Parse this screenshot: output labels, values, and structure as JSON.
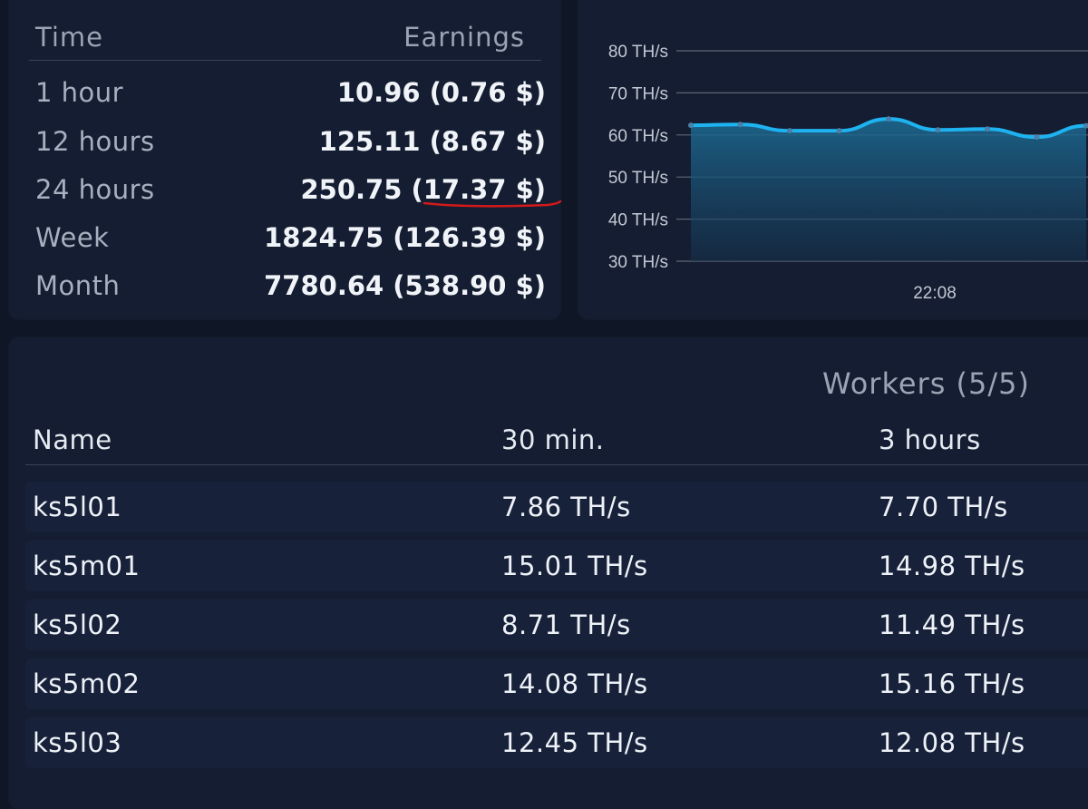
{
  "earnings": {
    "header": {
      "time": "Time",
      "earnings": "Earnings"
    },
    "rows": [
      {
        "label": "1 hour",
        "value": "10.96 (0.76 $)"
      },
      {
        "label": "12 hours",
        "value": "125.11 (8.67 $)"
      },
      {
        "label": "24 hours",
        "value": "250.75 (17.37 $)"
      },
      {
        "label": "Week",
        "value": "1824.75 (126.39 $)"
      },
      {
        "label": "Month",
        "value": "7780.64 (538.90 $)"
      }
    ],
    "annotation_color": "#d11a1a"
  },
  "chart_data": {
    "type": "area",
    "y_ticks": [
      "80 TH/s",
      "70 TH/s",
      "60 TH/s",
      "50 TH/s",
      "40 TH/s",
      "30 TH/s"
    ],
    "x_tick": "22:08",
    "ylim": [
      30,
      80
    ],
    "values": [
      62.3,
      62.5,
      61.0,
      61.0,
      63.8,
      61.2,
      61.4,
      59.5,
      62.2
    ],
    "line_color": "#1eb3f0",
    "grid": true
  },
  "workers": {
    "title": "Workers (5/5)",
    "columns": [
      "Name",
      "30 min.",
      "3 hours"
    ],
    "rows": [
      {
        "name": "ks5l01",
        "min30": "7.86 TH/s",
        "hours3": "7.70 TH/s"
      },
      {
        "name": "ks5m01",
        "min30": "15.01 TH/s",
        "hours3": "14.98 TH/s"
      },
      {
        "name": "ks5l02",
        "min30": "8.71 TH/s",
        "hours3": "11.49 TH/s"
      },
      {
        "name": "ks5m02",
        "min30": "14.08 TH/s",
        "hours3": "15.16 TH/s"
      },
      {
        "name": "ks5l03",
        "min30": "12.45 TH/s",
        "hours3": "12.08 TH/s"
      }
    ]
  }
}
